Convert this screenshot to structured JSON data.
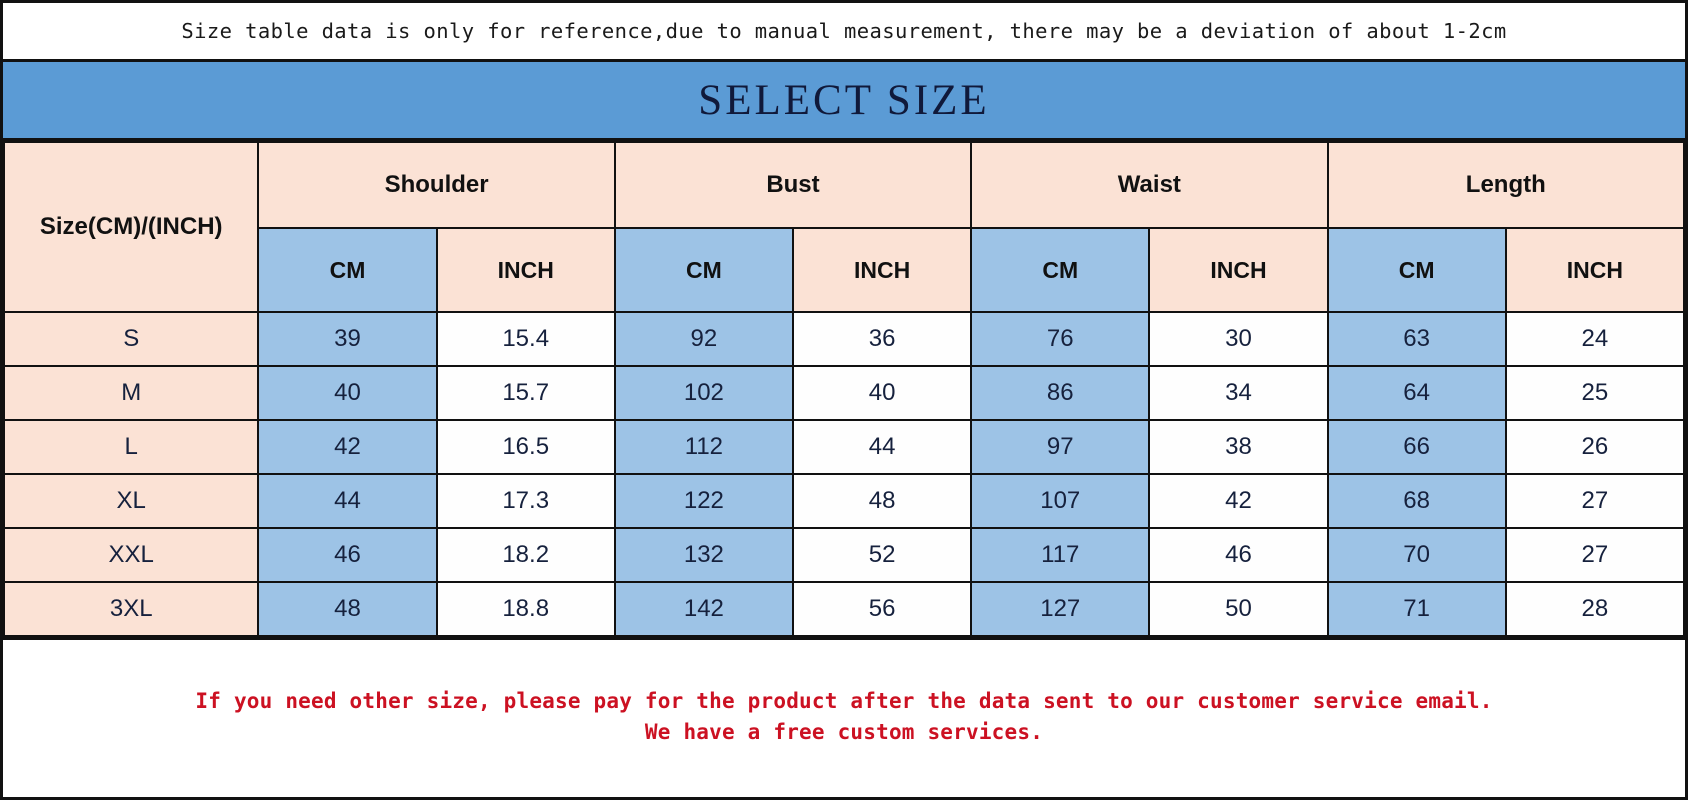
{
  "disclaimer": "Size table data is only for reference,due to manual measurement, there may be a deviation of about 1-2cm",
  "title": "SELECT SIZE",
  "colors": {
    "banner_blue": "#5B9BD5",
    "cell_blue": "#9DC3E6",
    "cell_peach": "#FBE2D5",
    "cell_white": "#FEFEFE",
    "border": "#111111",
    "note_red": "#CC1122",
    "title_navy": "#10193A"
  },
  "table": {
    "size_header": "Size(CM)/(INCH)",
    "measurement_groups": [
      "Shoulder",
      "Bust",
      "Waist",
      "Length"
    ],
    "unit_headers": [
      "CM",
      "INCH",
      "CM",
      "INCH",
      "CM",
      "INCH",
      "CM",
      "INCH"
    ],
    "rows": [
      {
        "size": "S",
        "values": [
          "39",
          "15.4",
          "92",
          "36",
          "76",
          "30",
          "63",
          "24"
        ]
      },
      {
        "size": "M",
        "values": [
          "40",
          "15.7",
          "102",
          "40",
          "86",
          "34",
          "64",
          "25"
        ]
      },
      {
        "size": "L",
        "values": [
          "42",
          "16.5",
          "112",
          "44",
          "97",
          "38",
          "66",
          "26"
        ]
      },
      {
        "size": "XL",
        "values": [
          "44",
          "17.3",
          "122",
          "48",
          "107",
          "42",
          "68",
          "27"
        ]
      },
      {
        "size": "XXL",
        "values": [
          "46",
          "18.2",
          "132",
          "52",
          "117",
          "46",
          "70",
          "27"
        ]
      },
      {
        "size": "3XL",
        "values": [
          "48",
          "18.8",
          "142",
          "56",
          "127",
          "50",
          "71",
          "28"
        ]
      }
    ]
  },
  "note": {
    "line1": "If you need other size, please pay for the product after the data sent to our customer service email.",
    "line2": "We have a free custom services."
  }
}
